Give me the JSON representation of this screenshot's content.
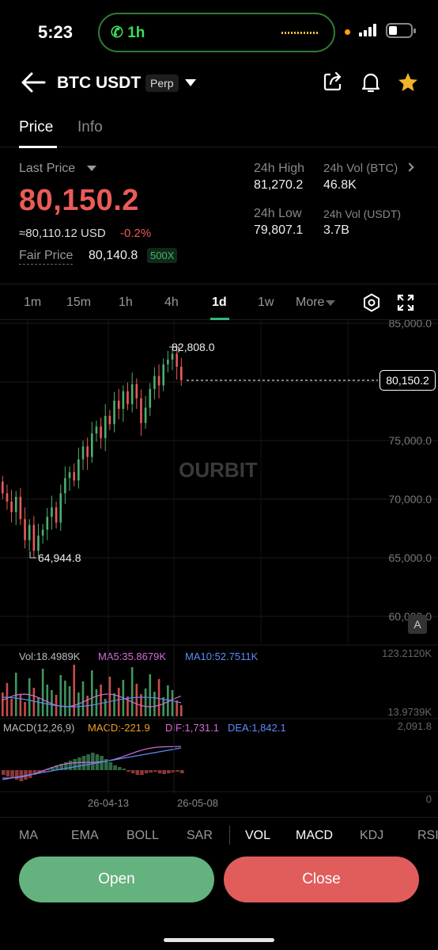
{
  "status_bar": {
    "time": "5:23",
    "call_label": "1h"
  },
  "header": {
    "pair": "BTC USDT",
    "badge": "Perp"
  },
  "tabs": [
    {
      "label": "Price"
    },
    {
      "label": "Info"
    }
  ],
  "price_panel": {
    "last_price_label": "Last Price",
    "last_price": "80,150.2",
    "usd_value": "≈80,110.12 USD",
    "change": "-0.2%",
    "fair_price_label": "Fair Price",
    "fair_price": "80,140.8",
    "leverage": "500X",
    "stats": {
      "high_label": "24h High",
      "high_value": "81,270.2",
      "low_label": "24h Low",
      "low_value": "79,807.1",
      "vol_btc_label": "24h Vol (BTC)",
      "vol_btc_value": "46.8K",
      "vol_usdt_label": "24h Vol (USDT)",
      "vol_usdt_value": "3.7B"
    }
  },
  "timeframes": [
    {
      "label": "1m"
    },
    {
      "label": "15m"
    },
    {
      "label": "1h"
    },
    {
      "label": "4h"
    },
    {
      "label": "1d",
      "active": true
    },
    {
      "label": "1w"
    },
    {
      "label": "More"
    }
  ],
  "chart_data": {
    "type": "candlestick",
    "watermark": "OURBIT",
    "y_axis_labels": [
      "85,000.0",
      "75,000.0",
      "70,000.0",
      "65,000.0",
      "60,000.0"
    ],
    "ylim": [
      60000,
      85000
    ],
    "high_marker": "82,808.0",
    "low_marker": "64,944.8",
    "current_price_tag": "80,150.2",
    "x_labels": [
      "26-04-13",
      "26-05-08"
    ],
    "volume": {
      "vol": "Vol:18.4989K",
      "ma5": "MA5:35.8679K",
      "ma10": "MA10:52.7511K",
      "axis_max": "123.2120K",
      "axis_min": "13.9739K"
    },
    "macd": {
      "label": "MACD(12,26,9)",
      "macd": "MACD:-221.9",
      "dif": "DIF:1,731.1",
      "dea": "DEA:1,842.1",
      "axis_max": "2,091.8",
      "axis_min": "0"
    },
    "auto_badge": "A"
  },
  "indicators": [
    {
      "label": "MA"
    },
    {
      "label": "EMA"
    },
    {
      "label": "BOLL"
    },
    {
      "label": "SAR"
    },
    {
      "label": "VOL",
      "active": true
    },
    {
      "label": "MACD",
      "active": true
    },
    {
      "label": "KDJ"
    },
    {
      "label": "RSI"
    }
  ],
  "actions": {
    "open": "Open",
    "close": "Close"
  },
  "colors": {
    "up": "#4caf70",
    "down": "#ea5b58",
    "open_btn": "#64b27d",
    "close_btn": "#e05d5c"
  }
}
